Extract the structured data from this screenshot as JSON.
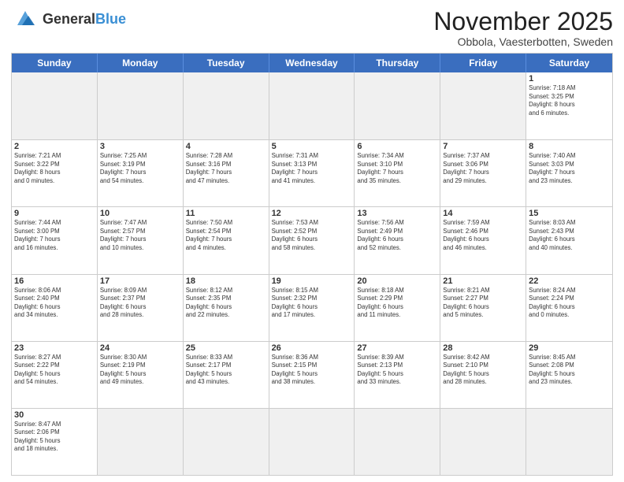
{
  "header": {
    "logo_general": "General",
    "logo_blue": "Blue",
    "title": "November 2025",
    "subtitle": "Obbola, Vaesterbotten, Sweden"
  },
  "days_of_week": [
    "Sunday",
    "Monday",
    "Tuesday",
    "Wednesday",
    "Thursday",
    "Friday",
    "Saturday"
  ],
  "weeks": [
    [
      {
        "day": "",
        "info": "",
        "empty": true
      },
      {
        "day": "",
        "info": "",
        "empty": true
      },
      {
        "day": "",
        "info": "",
        "empty": true
      },
      {
        "day": "",
        "info": "",
        "empty": true
      },
      {
        "day": "",
        "info": "",
        "empty": true
      },
      {
        "day": "",
        "info": "",
        "empty": true
      },
      {
        "day": "1",
        "info": "Sunrise: 7:18 AM\nSunset: 3:25 PM\nDaylight: 8 hours\nand 6 minutes."
      }
    ],
    [
      {
        "day": "2",
        "info": "Sunrise: 7:21 AM\nSunset: 3:22 PM\nDaylight: 8 hours\nand 0 minutes."
      },
      {
        "day": "3",
        "info": "Sunrise: 7:25 AM\nSunset: 3:19 PM\nDaylight: 7 hours\nand 54 minutes."
      },
      {
        "day": "4",
        "info": "Sunrise: 7:28 AM\nSunset: 3:16 PM\nDaylight: 7 hours\nand 47 minutes."
      },
      {
        "day": "5",
        "info": "Sunrise: 7:31 AM\nSunset: 3:13 PM\nDaylight: 7 hours\nand 41 minutes."
      },
      {
        "day": "6",
        "info": "Sunrise: 7:34 AM\nSunset: 3:10 PM\nDaylight: 7 hours\nand 35 minutes."
      },
      {
        "day": "7",
        "info": "Sunrise: 7:37 AM\nSunset: 3:06 PM\nDaylight: 7 hours\nand 29 minutes."
      },
      {
        "day": "8",
        "info": "Sunrise: 7:40 AM\nSunset: 3:03 PM\nDaylight: 7 hours\nand 23 minutes."
      }
    ],
    [
      {
        "day": "9",
        "info": "Sunrise: 7:44 AM\nSunset: 3:00 PM\nDaylight: 7 hours\nand 16 minutes."
      },
      {
        "day": "10",
        "info": "Sunrise: 7:47 AM\nSunset: 2:57 PM\nDaylight: 7 hours\nand 10 minutes."
      },
      {
        "day": "11",
        "info": "Sunrise: 7:50 AM\nSunset: 2:54 PM\nDaylight: 7 hours\nand 4 minutes."
      },
      {
        "day": "12",
        "info": "Sunrise: 7:53 AM\nSunset: 2:52 PM\nDaylight: 6 hours\nand 58 minutes."
      },
      {
        "day": "13",
        "info": "Sunrise: 7:56 AM\nSunset: 2:49 PM\nDaylight: 6 hours\nand 52 minutes."
      },
      {
        "day": "14",
        "info": "Sunrise: 7:59 AM\nSunset: 2:46 PM\nDaylight: 6 hours\nand 46 minutes."
      },
      {
        "day": "15",
        "info": "Sunrise: 8:03 AM\nSunset: 2:43 PM\nDaylight: 6 hours\nand 40 minutes."
      }
    ],
    [
      {
        "day": "16",
        "info": "Sunrise: 8:06 AM\nSunset: 2:40 PM\nDaylight: 6 hours\nand 34 minutes."
      },
      {
        "day": "17",
        "info": "Sunrise: 8:09 AM\nSunset: 2:37 PM\nDaylight: 6 hours\nand 28 minutes."
      },
      {
        "day": "18",
        "info": "Sunrise: 8:12 AM\nSunset: 2:35 PM\nDaylight: 6 hours\nand 22 minutes."
      },
      {
        "day": "19",
        "info": "Sunrise: 8:15 AM\nSunset: 2:32 PM\nDaylight: 6 hours\nand 17 minutes."
      },
      {
        "day": "20",
        "info": "Sunrise: 8:18 AM\nSunset: 2:29 PM\nDaylight: 6 hours\nand 11 minutes."
      },
      {
        "day": "21",
        "info": "Sunrise: 8:21 AM\nSunset: 2:27 PM\nDaylight: 6 hours\nand 5 minutes."
      },
      {
        "day": "22",
        "info": "Sunrise: 8:24 AM\nSunset: 2:24 PM\nDaylight: 6 hours\nand 0 minutes."
      }
    ],
    [
      {
        "day": "23",
        "info": "Sunrise: 8:27 AM\nSunset: 2:22 PM\nDaylight: 5 hours\nand 54 minutes."
      },
      {
        "day": "24",
        "info": "Sunrise: 8:30 AM\nSunset: 2:19 PM\nDaylight: 5 hours\nand 49 minutes."
      },
      {
        "day": "25",
        "info": "Sunrise: 8:33 AM\nSunset: 2:17 PM\nDaylight: 5 hours\nand 43 minutes."
      },
      {
        "day": "26",
        "info": "Sunrise: 8:36 AM\nSunset: 2:15 PM\nDaylight: 5 hours\nand 38 minutes."
      },
      {
        "day": "27",
        "info": "Sunrise: 8:39 AM\nSunset: 2:13 PM\nDaylight: 5 hours\nand 33 minutes."
      },
      {
        "day": "28",
        "info": "Sunrise: 8:42 AM\nSunset: 2:10 PM\nDaylight: 5 hours\nand 28 minutes."
      },
      {
        "day": "29",
        "info": "Sunrise: 8:45 AM\nSunset: 2:08 PM\nDaylight: 5 hours\nand 23 minutes."
      }
    ],
    [
      {
        "day": "30",
        "info": "Sunrise: 8:47 AM\nSunset: 2:06 PM\nDaylight: 5 hours\nand 18 minutes."
      },
      {
        "day": "",
        "info": "",
        "empty": true
      },
      {
        "day": "",
        "info": "",
        "empty": true
      },
      {
        "day": "",
        "info": "",
        "empty": true
      },
      {
        "day": "",
        "info": "",
        "empty": true
      },
      {
        "day": "",
        "info": "",
        "empty": true
      },
      {
        "day": "",
        "info": "",
        "empty": true
      }
    ]
  ]
}
